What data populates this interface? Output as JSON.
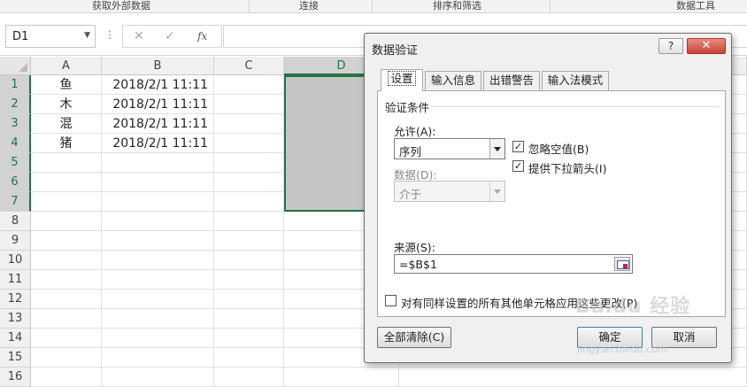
{
  "ribbon": {
    "groups": [
      "获取外部数据",
      "连接",
      "排序和筛选",
      "数据工具"
    ]
  },
  "formula_bar": {
    "name_box": "D1",
    "cancel_glyph": "✕",
    "enter_glyph": "✓",
    "fx_label": "fx",
    "formula": ""
  },
  "sheet": {
    "columns": [
      "A",
      "B",
      "C",
      "D"
    ],
    "rows": [
      "1",
      "2",
      "3",
      "4",
      "5",
      "6",
      "7",
      "8",
      "9",
      "10",
      "11",
      "12",
      "13",
      "14",
      "15",
      "16"
    ],
    "cells": [
      {
        "a": "鱼",
        "b": "2018/2/1 11:11"
      },
      {
        "a": "木",
        "b": "2018/2/1 11:11"
      },
      {
        "a": "混",
        "b": "2018/2/1 11:11"
      },
      {
        "a": "猪",
        "b": "2018/2/1 11:11"
      }
    ],
    "selected_column": "D"
  },
  "dialog": {
    "title": "数据验证",
    "help": "?",
    "close": "✕",
    "tabs": [
      "设置",
      "输入信息",
      "出错警告",
      "输入法模式"
    ],
    "active_tab": 0,
    "section": "验证条件",
    "allow_label": "允许(A):",
    "allow_value": "序列",
    "ignore_blank_label": "忽略空值(B)",
    "ignore_blank_checked": true,
    "dropdown_label": "提供下拉箭头(I)",
    "dropdown_checked": true,
    "data_label": "数据(D):",
    "data_value": "介于",
    "source_label": "来源(S):",
    "source_value": "=$B$1",
    "apply_all_label": "对有同样设置的所有其他单元格应用这些更改(P)",
    "apply_all_checked": false,
    "clear_all": "全部清除(C)",
    "ok": "确定",
    "cancel": "取消"
  },
  "watermark": {
    "brand": "Baidu 经验",
    "url": "jingyan.baidu.com"
  }
}
